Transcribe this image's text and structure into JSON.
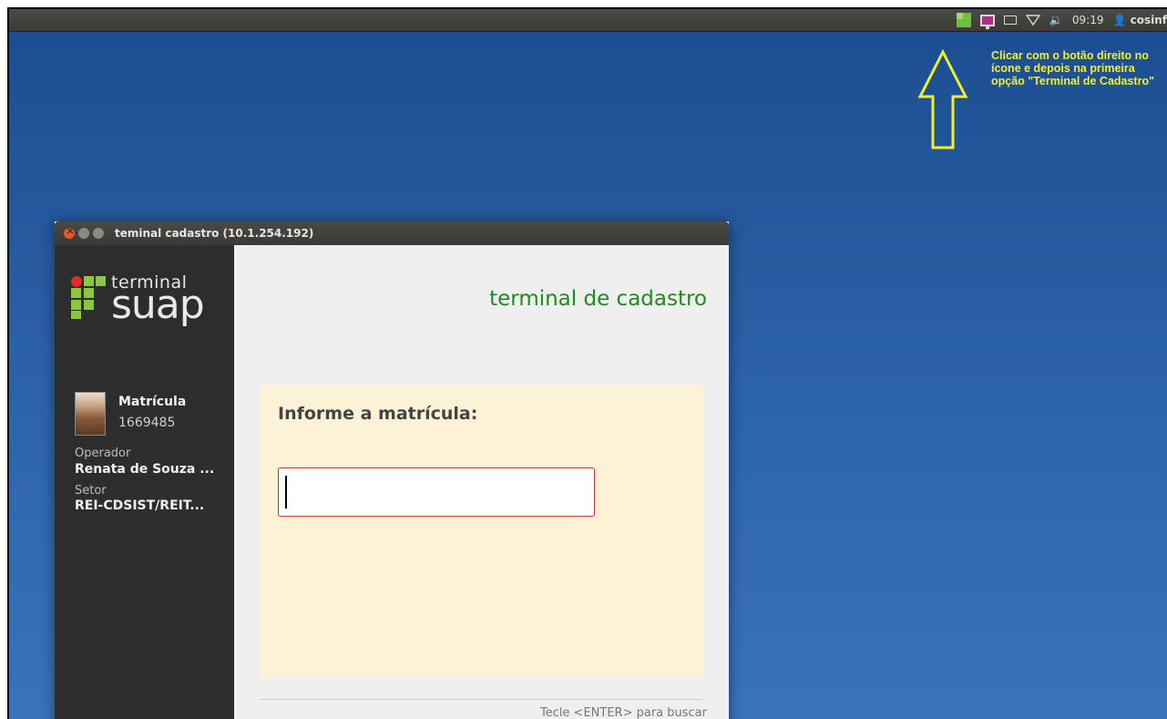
{
  "top_panel": {
    "time": "09:19",
    "user": "cosinf",
    "icons": [
      "suap-tray-icon",
      "monitor-icon",
      "mail-icon",
      "wifi-icon",
      "volume-icon",
      "user-icon"
    ]
  },
  "annotation": {
    "text": "Clicar com o botão direito no ícone e depois na primeira opção \"Terminal de Cadastro\"",
    "color": "#f2ef2a"
  },
  "window": {
    "title": "teminal cadastro (10.1.254.192)"
  },
  "sidebar": {
    "logo_terminal": "terminal",
    "logo_suap": "suap",
    "matricula_label": "Matrícula",
    "matricula_value": "1669485",
    "operador_label": "Operador",
    "operador_value": "Renata de Souza ...",
    "setor_label": "Setor",
    "setor_value": "REI-CDSIST/REIT..."
  },
  "main": {
    "title": "terminal de cadastro",
    "prompt_label": "Informe a matrícula:",
    "input_value": "",
    "hint": "Tecle <ENTER> para buscar"
  },
  "colors": {
    "desktop": "#2a5fa5",
    "accent_green": "#1f8a1f",
    "logo_green": "#8cc63f",
    "logo_red": "#e62828",
    "card_bg": "#fdf2d6"
  }
}
